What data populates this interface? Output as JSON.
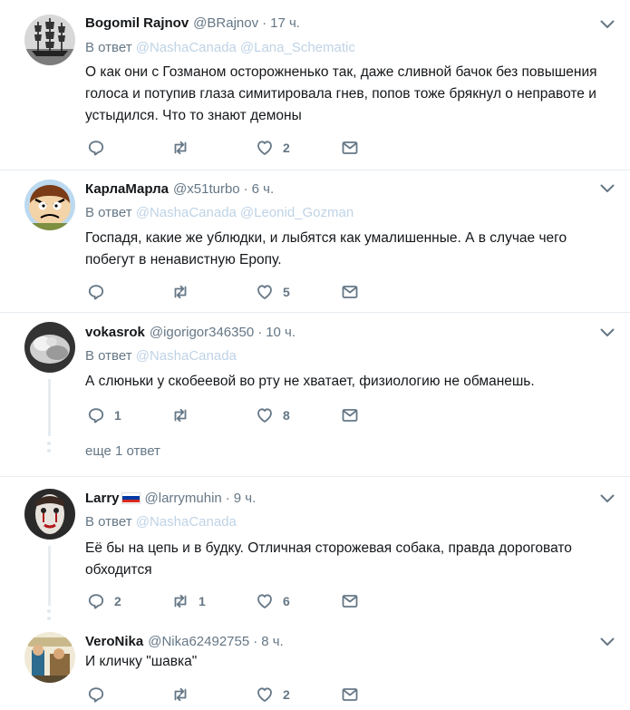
{
  "tweets": [
    {
      "name": "Bogomil Rajnov",
      "handle": "@BRajnov",
      "time": "17 ч.",
      "reply_label": "В ответ",
      "mentions": [
        "@NashaCanada",
        "@Lana_Schematic"
      ],
      "text": "О как они с Гозманом осторожненько так, даже сливной бачок без повышения голоса и потупив глаза симитировала гнев, попов тоже брякнул о неправоте и устыдился. Что то знают демоны",
      "counts": {
        "reply": "",
        "retweet": "",
        "like": "2"
      }
    },
    {
      "name": "КарлаМарла",
      "handle": "@x51turbo",
      "time": "6 ч.",
      "reply_label": "В ответ",
      "mentions": [
        "@NashaCanada",
        "@Leonid_Gozman"
      ],
      "text": "Госпадя, какие же ублюдки, и лыбятся как умалишенные. А в случае чего побегут в ненавистную Еропу.",
      "counts": {
        "reply": "",
        "retweet": "",
        "like": "5"
      }
    },
    {
      "name": "vokasrok",
      "handle": "@igorigor346350",
      "time": "10 ч.",
      "reply_label": "В ответ",
      "mentions": [
        "@NashaCanada"
      ],
      "text": "А слюньки у скобеевой во рту не хватает, физиологию не обманешь.",
      "counts": {
        "reply": "1",
        "retweet": "",
        "like": "8"
      },
      "more_replies": "еще 1 ответ"
    },
    {
      "name": "Larry",
      "handle": "@larrymuhin",
      "time": "9 ч.",
      "reply_label": "В ответ",
      "mentions": [
        "@NashaCanada"
      ],
      "text": "Её бы на цепь и в будку. Отличная сторожевая собака, правда дороговато обходится",
      "counts": {
        "reply": "2",
        "retweet": "1",
        "like": "6"
      }
    },
    {
      "name": "VeroNika",
      "handle": "@Nika62492755",
      "time": "8 ч.",
      "text": "И кличку \"шавка\"",
      "counts": {
        "reply": "",
        "retweet": "",
        "like": "2"
      }
    }
  ],
  "separator": "·",
  "icons": [
    "reply-icon",
    "retweet-icon",
    "like-icon",
    "direct-message-icon",
    "chevron-down-icon"
  ],
  "colors": {
    "icon": "#657786",
    "mention": "#bfd3e6",
    "border": "#e6ecf0"
  }
}
